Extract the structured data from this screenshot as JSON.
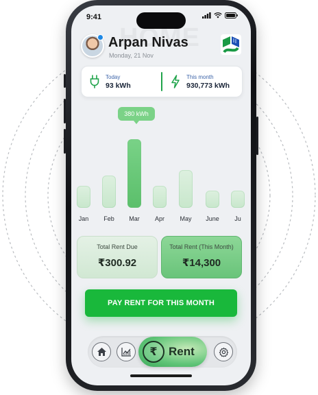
{
  "status_bar": {
    "time": "9:41"
  },
  "header": {
    "watermark": "HOME",
    "user_name": "Arpan Nivas",
    "date": "Monday, 21 Nov"
  },
  "summary": {
    "today_label": "Today",
    "today_value": "93 kWh",
    "month_label": "This month",
    "month_value": "930,773 kWh"
  },
  "chart_data": {
    "type": "bar",
    "categories": [
      "Jan",
      "Feb",
      "Mar",
      "Apr",
      "May",
      "June",
      "Ju"
    ],
    "values": [
      120,
      180,
      380,
      120,
      210,
      95,
      95
    ],
    "highlight_index": 2,
    "tooltip": "380 kWh",
    "title": "",
    "xlabel": "",
    "ylabel": ""
  },
  "rent": {
    "due_label": "Total Rent Due",
    "due_value": "₹300.92",
    "total_label": "Total Rent (This Month)",
    "total_value": "₹14,300"
  },
  "pay_button": {
    "label": "PAY RENT FOR THIS MONTH"
  },
  "nav": {
    "rent_label": "Rent",
    "rupee_symbol": "₹"
  },
  "colors": {
    "accent": "#19b83b",
    "bar_active": "#5bbf6b",
    "bar_inactive": "#d3ecd6",
    "summary_label": "#3c63a8"
  }
}
